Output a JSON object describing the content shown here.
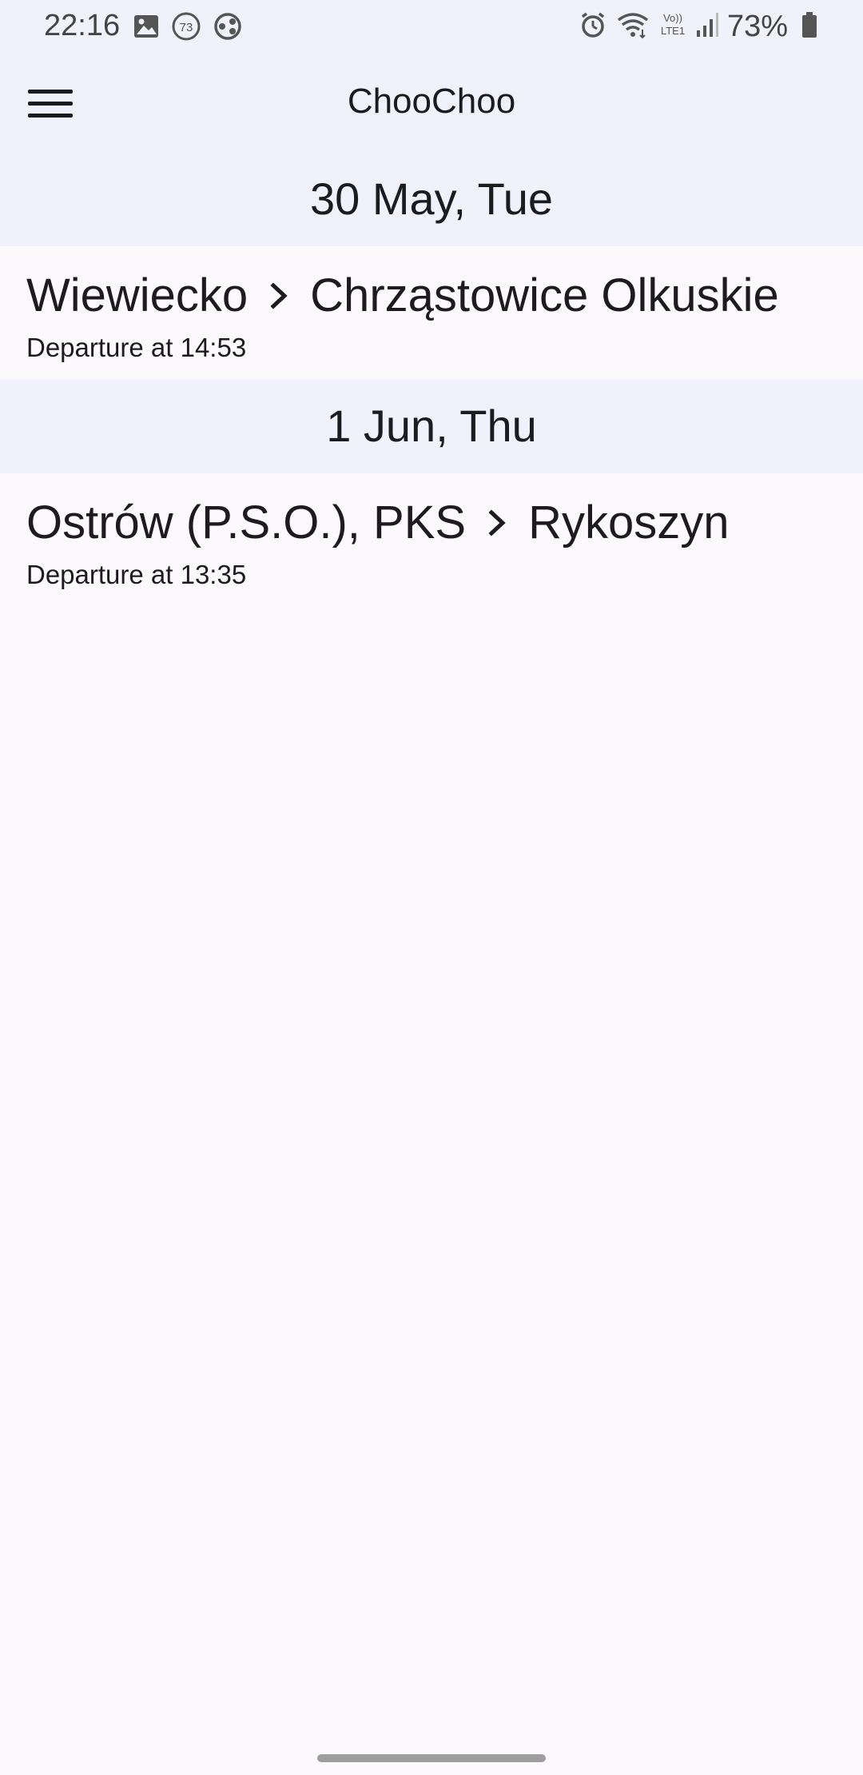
{
  "status_bar": {
    "time": "22:16",
    "notification_badge": "73",
    "battery_percent": "73%",
    "icons_left": [
      "gallery-icon",
      "badge-icon",
      "sync-icon"
    ],
    "icons_right": [
      "alarm-icon",
      "wifi-icon",
      "volte-icon",
      "signal-icon",
      "battery-icon"
    ],
    "volte_label": "Vo)) LTE1"
  },
  "app_bar": {
    "title": "ChooChoo",
    "menu_icon": "hamburger-menu-icon"
  },
  "sections": [
    {
      "date": "30 May, Tue",
      "trips": [
        {
          "from": "Wiewiecko",
          "to": "Chrząstowice Olkuskie",
          "departure": "Departure at 14:53"
        }
      ]
    },
    {
      "date": "1 Jun, Thu",
      "trips": [
        {
          "from": "Ostrów (P.S.O.), PKS",
          "to": "Rykoszyn",
          "departure": "Departure at 13:35"
        }
      ]
    }
  ],
  "colors": {
    "header_bg": "#f0f1fa",
    "page_bg": "#fcf9fd",
    "text": "#1c1b1f"
  }
}
